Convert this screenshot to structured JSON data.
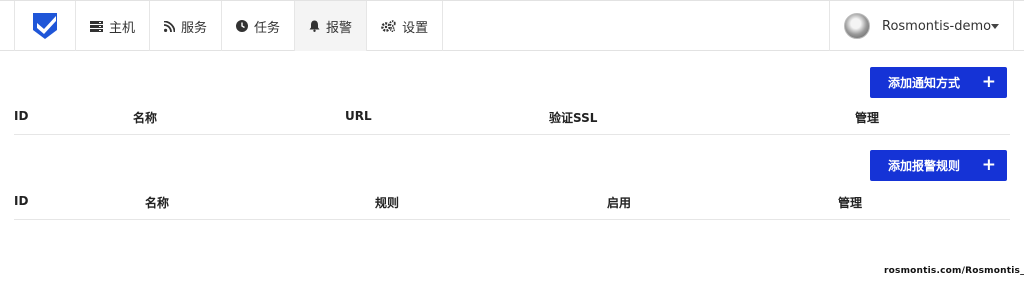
{
  "nav": {
    "items": [
      {
        "label": "主机",
        "icon": "server-icon",
        "active": false
      },
      {
        "label": "服务",
        "icon": "rss-icon",
        "active": false
      },
      {
        "label": "任务",
        "icon": "clock-icon",
        "active": false
      },
      {
        "label": "报警",
        "icon": "bell-icon",
        "active": true
      },
      {
        "label": "设置",
        "icon": "gears-icon",
        "active": false
      }
    ]
  },
  "user": {
    "name": "Rosmontis-demo"
  },
  "notify": {
    "button_label": "添加通知方式",
    "button_icon": "+",
    "columns": [
      "ID",
      "名称",
      "URL",
      "验证SSL",
      "管理"
    ]
  },
  "rules": {
    "button_label": "添加报警规则",
    "button_icon": "+",
    "columns": [
      "ID",
      "名称",
      "规则",
      "启用",
      "管理"
    ]
  },
  "footer": {
    "text": "rosmontis.com/Rosmontis_Blog"
  },
  "colors": {
    "accent": "#1533d6",
    "logo": "#1f56d8"
  }
}
